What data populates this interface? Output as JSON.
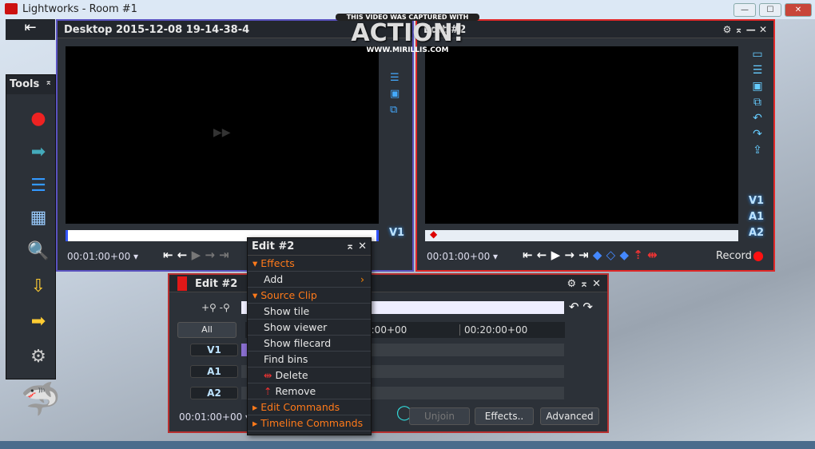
{
  "window": {
    "title": "Lightworks - Room #1",
    "min": "—",
    "max": "☐",
    "close": "✕"
  },
  "watermark": {
    "line1": "THIS VIDEO WAS CAPTURED WITH",
    "logo": "ACTION!",
    "url": "WWW.MIRILLIS.COM"
  },
  "tools": {
    "title": "Tools",
    "pin": "⌅"
  },
  "source_viewer": {
    "title": "Desktop 2015-12-08 19-14-38-4",
    "timecode": "00:01:00+00",
    "track": "V1"
  },
  "record_viewer": {
    "title": "Edit #2",
    "timecode": "00:01:00+00",
    "tracks": [
      "V1",
      "A1",
      "A2"
    ],
    "record_label": "Record"
  },
  "edit_panel": {
    "title": "Edit #2",
    "all_label": "All",
    "ruler": [
      "0:00+00",
      "00:20:00+00"
    ],
    "tracks": [
      "V1",
      "A1",
      "A2"
    ],
    "timecode": "00:01:00+00",
    "buttons": {
      "unjoin": "Unjoin",
      "effects": "Effects..",
      "advanced": "Advanced"
    }
  },
  "context_menu": {
    "title": "Edit #2",
    "items": [
      {
        "label": "Effects",
        "type": "header"
      },
      {
        "label": "Add",
        "type": "submenu"
      },
      {
        "label": "Source Clip",
        "type": "header"
      },
      {
        "label": "Show tile",
        "type": "item"
      },
      {
        "label": "Show viewer",
        "type": "item"
      },
      {
        "label": "Show filecard",
        "type": "item"
      },
      {
        "label": "Find bins",
        "type": "item"
      },
      {
        "label": "Delete",
        "type": "item"
      },
      {
        "label": "Remove",
        "type": "item"
      },
      {
        "label": "Edit Commands",
        "type": "collapsed"
      },
      {
        "label": "Timeline Commands",
        "type": "collapsed"
      }
    ]
  }
}
